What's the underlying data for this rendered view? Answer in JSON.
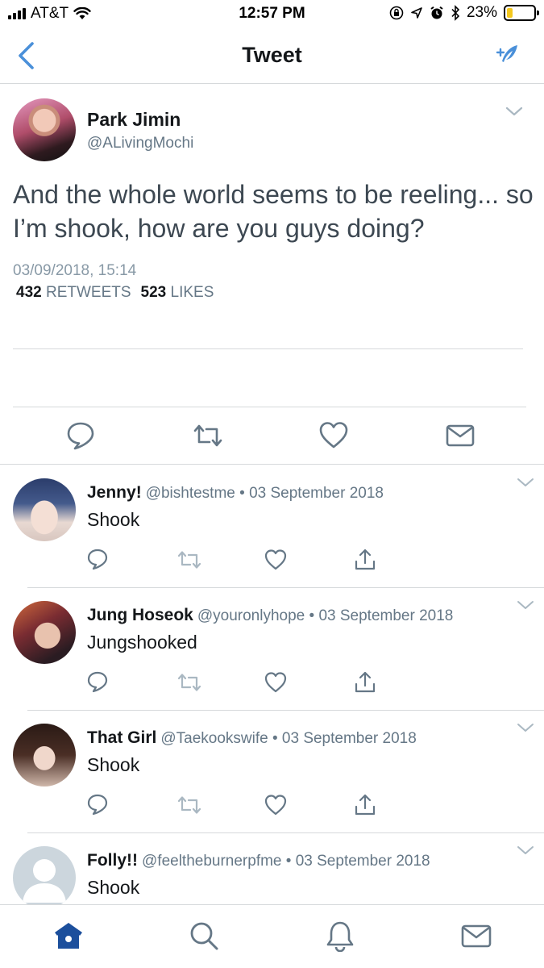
{
  "status_bar": {
    "carrier": "AT&T",
    "time": "12:57 PM",
    "battery_percent": "23%",
    "battery_level": 0.23,
    "icons": [
      "signal-icon",
      "wifi-icon",
      "orientation-lock-icon",
      "location-icon",
      "alarm-icon",
      "bluetooth-icon",
      "battery-icon"
    ]
  },
  "nav": {
    "title": "Tweet",
    "back_icon": "chevron-left-icon",
    "compose_icon": "compose-tweet-icon"
  },
  "tweet": {
    "author_name": "Park Jimin",
    "author_handle": "@ALivingMochi",
    "text": "And the whole world seems to be reeling... so I’m shook, how are you guys doing?",
    "date": "03/09/2018, 15:14",
    "retweet_count": "432",
    "retweet_label": "RETWEETS",
    "like_count": "523",
    "like_label": "LIKES",
    "actions": [
      "reply-icon",
      "retweet-icon",
      "like-icon",
      "direct-message-icon"
    ]
  },
  "replies": [
    {
      "name": "Jenny!",
      "handle": "@bishtestme",
      "separator": "•",
      "date": "03 September 2018",
      "text": "Shook"
    },
    {
      "name": "Jung Hoseok",
      "handle": "@youronlyhope",
      "separator": "•",
      "date": "03 September 2018",
      "text": "Jungshooked"
    },
    {
      "name": "That Girl",
      "handle": "@Taekookswife",
      "separator": "•",
      "date": "03 September 2018",
      "text": "Shook"
    },
    {
      "name": "Folly!!",
      "handle": "@feeltheburnerpfme",
      "separator": "•",
      "date": "03 September 2018",
      "text": "Shook"
    }
  ],
  "tab_bar": {
    "tabs": [
      "home-icon",
      "search-icon",
      "notifications-icon",
      "messages-icon"
    ],
    "active_tab": "home-icon"
  },
  "colors": {
    "accent": "#1da1f2",
    "nav_accent": "#4a90d9",
    "secondary_text": "#657786",
    "icon_gray": "#657786",
    "home_active": "#1c4f9c",
    "battery_fill": "#f4c81e"
  }
}
